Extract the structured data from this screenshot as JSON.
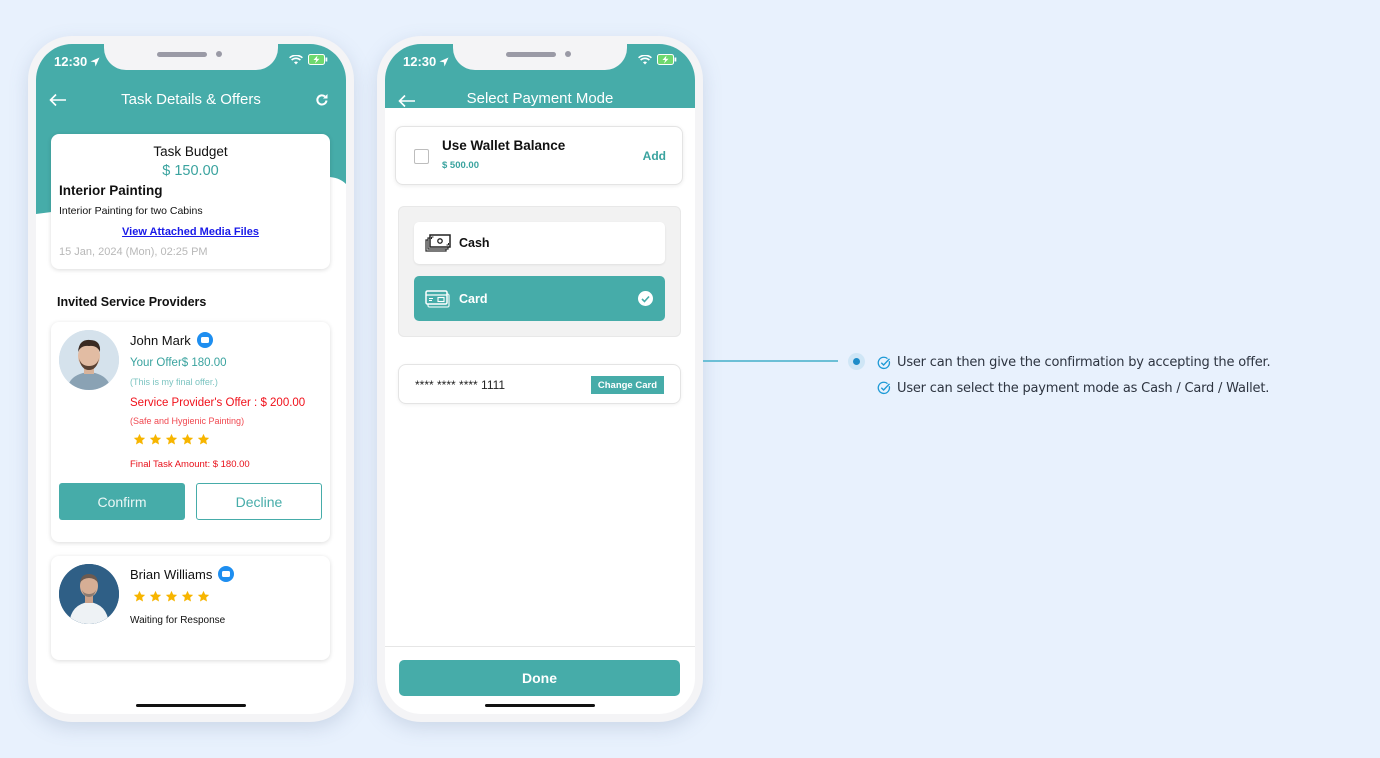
{
  "status_bar": {
    "time": "12:30"
  },
  "screen1": {
    "title": "Task Details & Offers",
    "budget": {
      "label": "Task Budget",
      "value": "$ 150.00",
      "task_title": "Interior Painting",
      "task_description": "Interior Painting for two Cabins",
      "media_link": "View Attached Media Files",
      "date": "15 Jan, 2024 (Mon),  02:25 PM"
    },
    "section_title": "Invited Service Providers",
    "providers": [
      {
        "name": "John Mark",
        "your_offer": "Your Offer$ 180.00",
        "your_offer_note": "(This is my final offer.)",
        "sp_offer": "Service Provider's Offer : $ 200.00",
        "sp_offer_note": "(Safe and Hygienic Painting)",
        "rating": 5,
        "final_amount": "Final Task Amount: $ 180.00",
        "confirm_label": "Confirm",
        "decline_label": "Decline"
      },
      {
        "name": "Brian Williams",
        "rating": 5,
        "status": "Waiting for Response"
      }
    ]
  },
  "screen2": {
    "title": "Select Payment Mode",
    "wallet": {
      "label": "Use Wallet Balance",
      "amount": "$ 500.00",
      "checked": false,
      "add_label": "Add"
    },
    "payment_modes": [
      {
        "label": "Cash",
        "icon": "cash-icon",
        "selected": false
      },
      {
        "label": "Card",
        "icon": "card-icon",
        "selected": true
      }
    ],
    "card_number": "**** **** **** 1111",
    "change_card_label": "Change Card",
    "done_label": "Done"
  },
  "annotation": {
    "bullets": [
      "User can then give the confirmation by accepting the offer.",
      "User can select the payment mode as Cash / Card / Wallet."
    ]
  },
  "colors": {
    "accent": "#46aca9",
    "background": "#e8f1fd",
    "offer_red": "#f0101a",
    "link_blue": "#1a1ae8",
    "star": "#f7b500"
  }
}
